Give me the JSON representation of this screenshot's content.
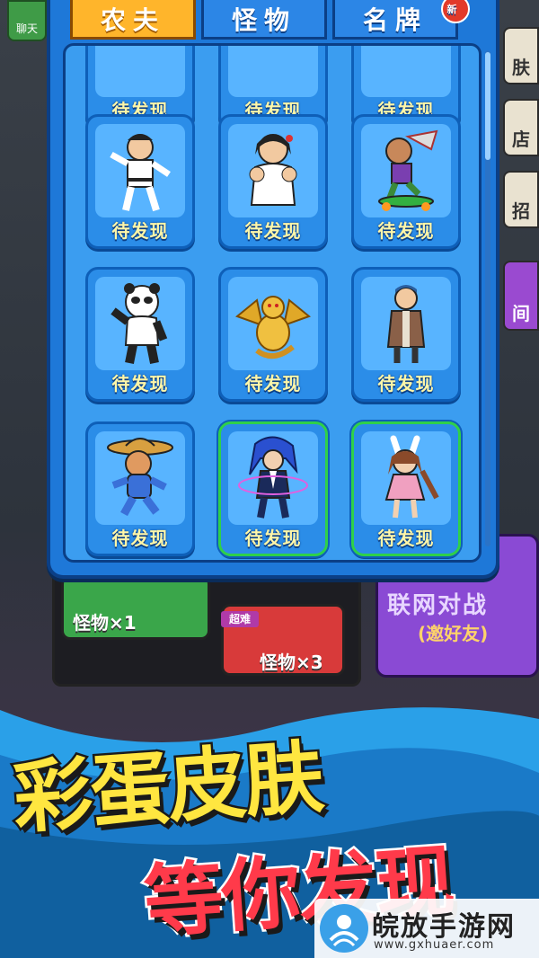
{
  "tabs": [
    {
      "label": "农夫",
      "active": true
    },
    {
      "label": "怪物",
      "active": false
    },
    {
      "label": "名牌",
      "active": false,
      "badge": "新"
    }
  ],
  "cells": [
    {
      "label": "待发现",
      "character": "partial-top-1",
      "owned": false
    },
    {
      "label": "待发现",
      "character": "partial-top-2",
      "owned": false
    },
    {
      "label": "待发现",
      "character": "partial-top-3",
      "owned": false
    },
    {
      "label": "待发现",
      "character": "kungfu-man",
      "owned": false
    },
    {
      "label": "待发现",
      "character": "big-lady",
      "owned": false
    },
    {
      "label": "待发现",
      "character": "hoverboard-monkey",
      "owned": false
    },
    {
      "label": "待发现",
      "character": "panda-man",
      "owned": false
    },
    {
      "label": "待发现",
      "character": "golden-dragon",
      "owned": false
    },
    {
      "label": "待发现",
      "character": "coat-man",
      "owned": false
    },
    {
      "label": "待发现",
      "character": "straw-hat-boy",
      "owned": false
    },
    {
      "label": "待发现",
      "character": "blue-hair-warrior",
      "owned": true
    },
    {
      "label": "待发现",
      "character": "bunny-girl",
      "owned": true
    }
  ],
  "side_buttons": [
    "肤",
    "店",
    "招",
    "间"
  ],
  "chat_label": "聊天",
  "modes": {
    "monster1": "怪物×1",
    "monster3": "怪物×3",
    "hard_badge": "超难",
    "online_title": "联网对战",
    "online_sub": "(邀好友)"
  },
  "promo": {
    "line1": "彩蛋皮肤",
    "line2": "等你发现"
  },
  "watermark": {
    "name": "皖放手游网",
    "url": "www.gxhuaer.com"
  },
  "colors": {
    "panel": "#1e78d8",
    "tab_active": "#ffb52b",
    "label": "#fff6a8",
    "owned_border": "#2fd04a",
    "promo_yellow": "#ffe640",
    "promo_red": "#ff3a4a"
  }
}
